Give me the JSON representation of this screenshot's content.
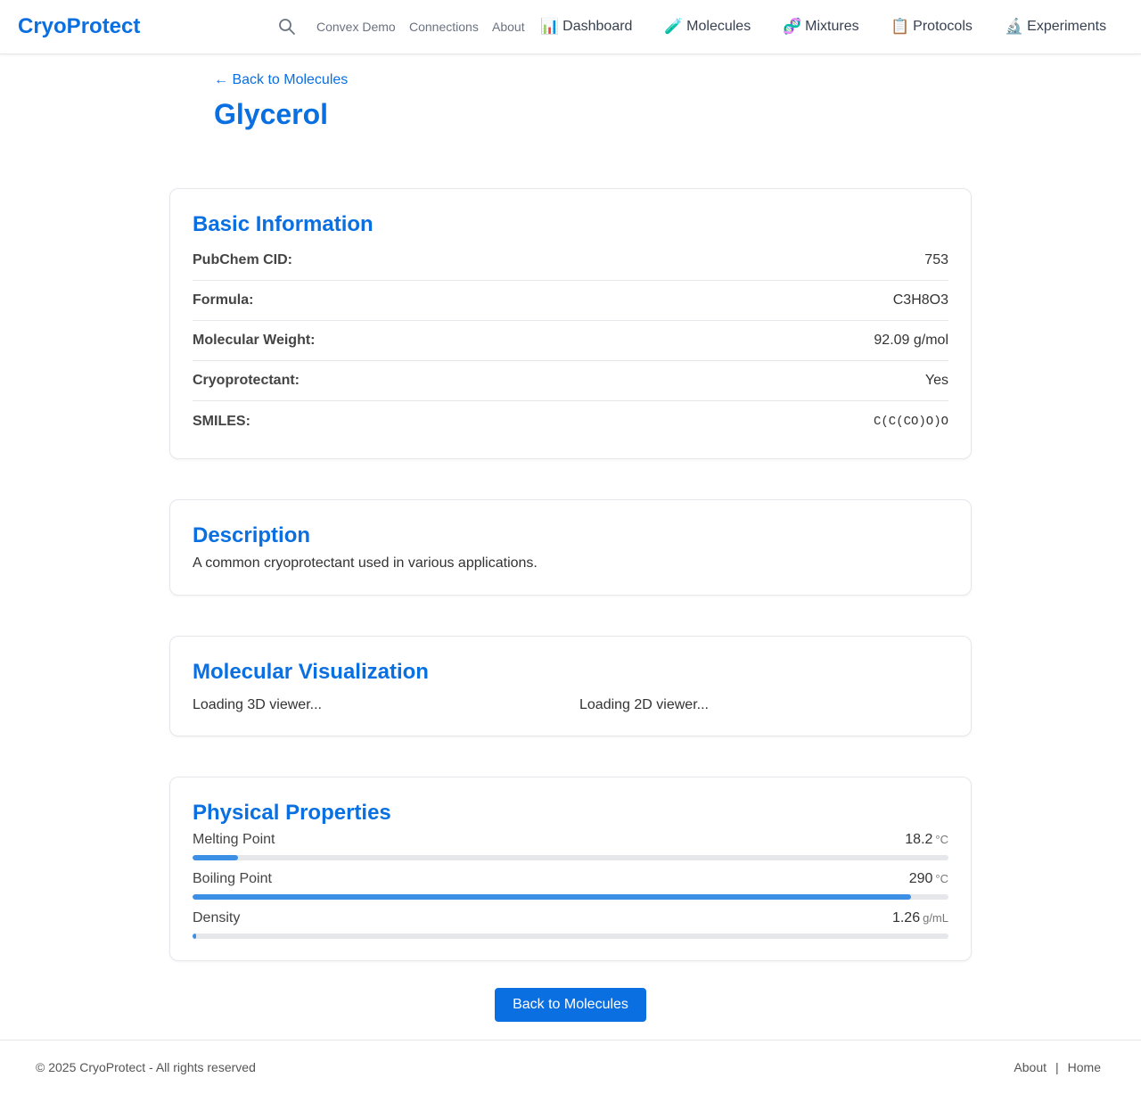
{
  "header": {
    "brand": "CryoProtect",
    "nav_small": [
      "Convex Demo",
      "Connections",
      "About"
    ],
    "nav_main": [
      {
        "icon": "📊",
        "icon_name": "chart-icon",
        "label": "Dashboard"
      },
      {
        "icon": "🧪",
        "icon_name": "test-tube-icon",
        "label": "Molecules"
      },
      {
        "icon": "🧬",
        "icon_name": "dna-icon",
        "label": "Mixtures"
      },
      {
        "icon": "📋",
        "icon_name": "clipboard-icon",
        "label": "Protocols"
      },
      {
        "icon": "🔬",
        "icon_name": "microscope-icon",
        "label": "Experiments"
      }
    ]
  },
  "page": {
    "back_link": "← Back to Molecules",
    "title": "Glycerol"
  },
  "basic_info": {
    "heading": "Basic Information",
    "rows": [
      {
        "label": "PubChem CID:",
        "value": "753"
      },
      {
        "label": "Formula:",
        "value": "C3H8O3"
      },
      {
        "label": "Molecular Weight:",
        "value": "92.09 g/mol"
      },
      {
        "label": "Cryoprotectant:",
        "value": "Yes"
      },
      {
        "label": "SMILES:",
        "value": "C(C(CO)O)O"
      }
    ]
  },
  "description": {
    "heading": "Description",
    "text": "A common cryoprotectant used in various applications."
  },
  "visualization": {
    "heading": "Molecular Visualization",
    "viewer_3d": "Loading 3D viewer...",
    "viewer_2d": "Loading 2D viewer..."
  },
  "physical_properties": {
    "heading": "Physical Properties",
    "items": [
      {
        "label": "Melting Point",
        "value": "18.2",
        "unit": "°C",
        "fill_fraction": 0.06
      },
      {
        "label": "Boiling Point",
        "value": "290",
        "unit": "°C",
        "fill_fraction": 0.95
      },
      {
        "label": "Density",
        "value": "1.26",
        "unit": "g/mL",
        "fill_fraction": 0.005
      }
    ]
  },
  "back_button": "Back to Molecules",
  "footer": {
    "copyright": "© 2025 CryoProtect - All rights reserved",
    "links": [
      "About",
      "|",
      "Home"
    ]
  },
  "colors": {
    "accent": "#0a6fe0",
    "bar_fill": "#3b8fe5",
    "bar_track": "#e5e7eb"
  }
}
